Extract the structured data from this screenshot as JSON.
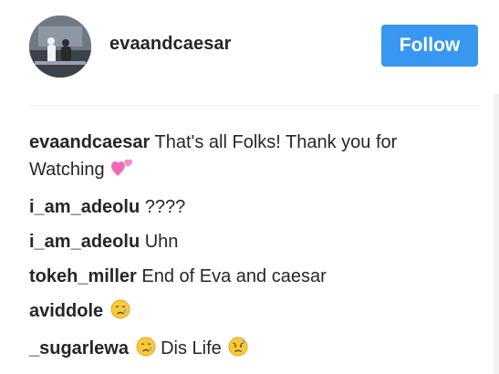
{
  "post": {
    "username": "evaandcaesar",
    "follow_label": "Follow"
  },
  "comments": [
    {
      "user": "evaandcaesar",
      "text": "That's all Folks! Thank you for Watching",
      "emoji": "two-hearts-icon"
    },
    {
      "user": "i_am_adeolu",
      "text": "????",
      "emoji": ""
    },
    {
      "user": "i_am_adeolu",
      "text": "Uhn",
      "emoji": ""
    },
    {
      "user": "tokeh_miller",
      "text": "End of Eva and caesar",
      "emoji": ""
    },
    {
      "user": "aviddole",
      "text": "",
      "emoji": "crying-face-icon"
    },
    {
      "user": "_sugarlewa",
      "text": "Dis Life",
      "emoji": "crying-face-icon"
    }
  ],
  "colors": {
    "accent": "#3897f0",
    "text": "#262626",
    "divider": "#efefef"
  }
}
